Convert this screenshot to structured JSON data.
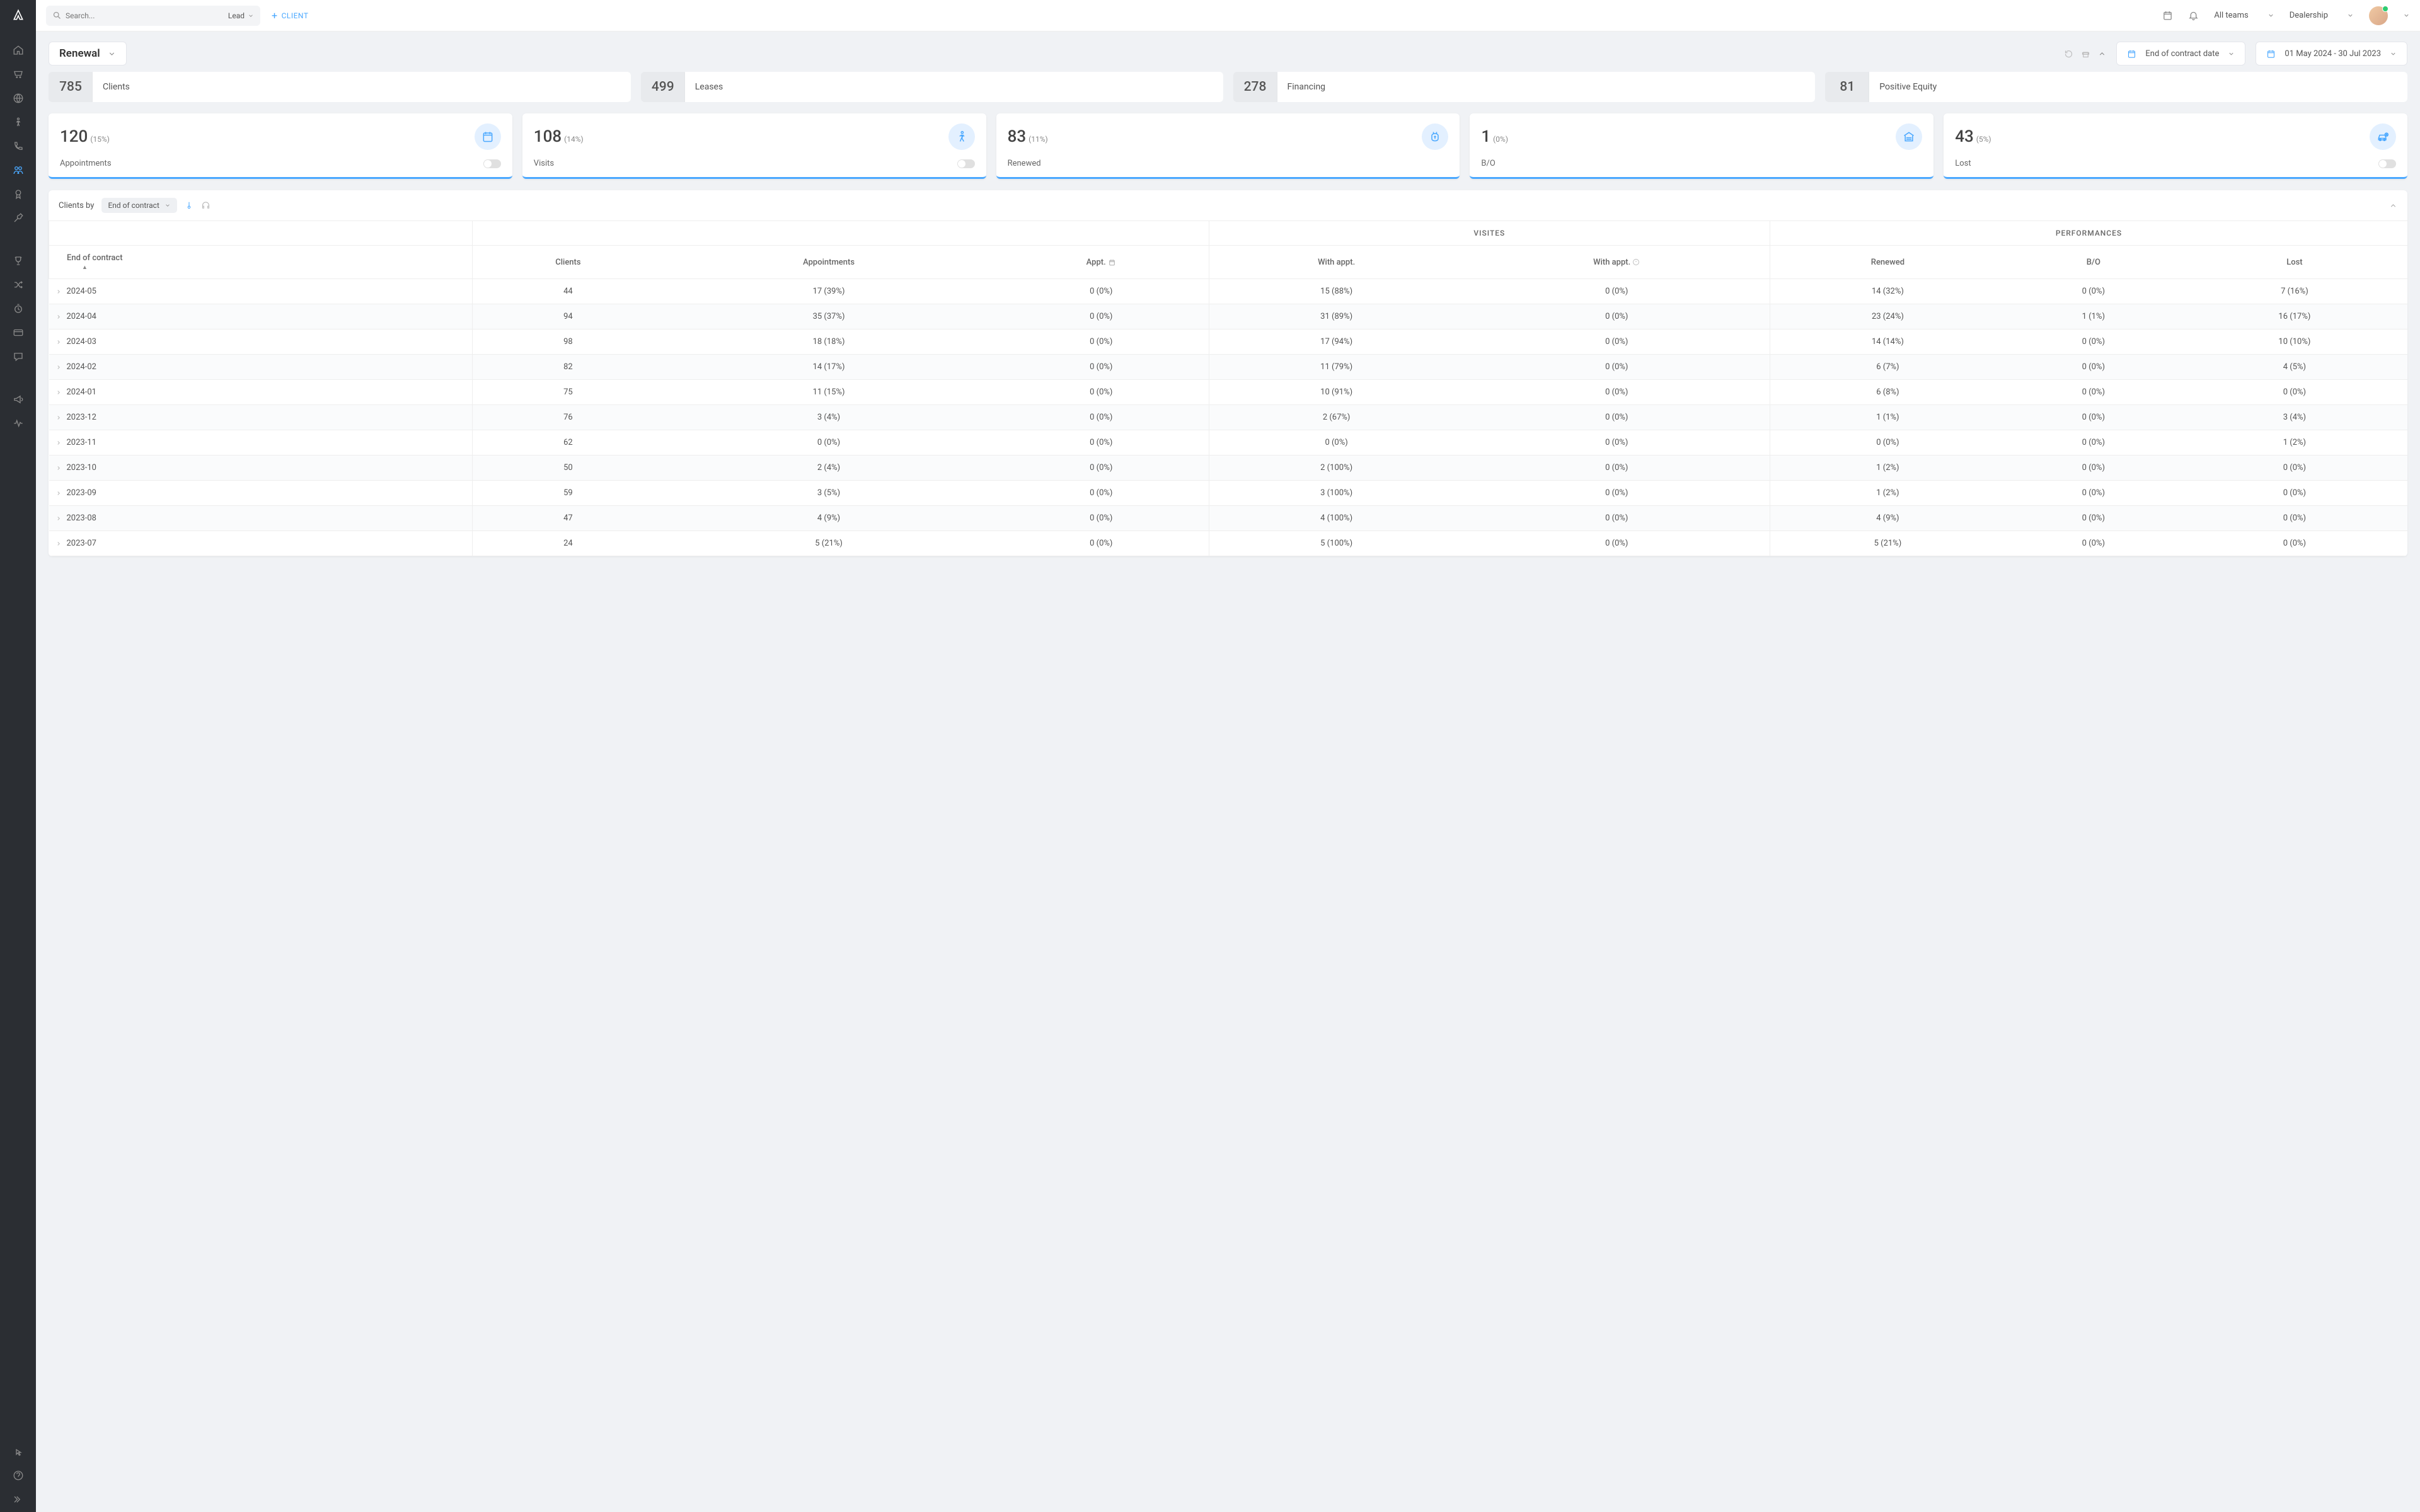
{
  "topbar": {
    "search_placeholder": "Search...",
    "search_type": "Lead",
    "client_btn": "CLIENT",
    "team_selector": "All teams",
    "scope_selector": "Dealership"
  },
  "page": {
    "title": "Renewal",
    "filter_label": "End of contract date",
    "date_range": "01 May 2024 - 30 Jul 2023"
  },
  "summary": [
    {
      "value": "785",
      "label": "Clients"
    },
    {
      "value": "499",
      "label": "Leases"
    },
    {
      "value": "278",
      "label": "Financing"
    },
    {
      "value": "81",
      "label": "Positive Equity"
    }
  ],
  "metrics": [
    {
      "value": "120",
      "pct": "(15%)",
      "label": "Appointments",
      "icon": "calendar",
      "toggle": true
    },
    {
      "value": "108",
      "pct": "(14%)",
      "label": "Visits",
      "icon": "walk",
      "toggle": true
    },
    {
      "value": "83",
      "pct": "(11%)",
      "label": "Renewed",
      "icon": "money",
      "toggle": false
    },
    {
      "value": "1",
      "pct": "(0%)",
      "label": "B/O",
      "icon": "garage",
      "toggle": false
    },
    {
      "value": "43",
      "pct": "(5%)",
      "label": "Lost",
      "icon": "lostcar",
      "toggle": true
    }
  ],
  "table": {
    "prefix": "Clients by",
    "group_label": "End of contract",
    "group_headers": {
      "visits": "VISITES",
      "perf": "PERFORMANCES"
    },
    "columns": [
      "End of contract",
      "Clients",
      "Appointments",
      "Appt.",
      "With appt.",
      "With appt.",
      "Renewed",
      "B/O",
      "Lost"
    ],
    "rows": [
      {
        "c": [
          "2024-05",
          "44",
          "17 (39%)",
          "0 (0%)",
          "15 (88%)",
          "0 (0%)",
          "14 (32%)",
          "0 (0%)",
          "7 (16%)"
        ]
      },
      {
        "c": [
          "2024-04",
          "94",
          "35 (37%)",
          "0 (0%)",
          "31 (89%)",
          "0 (0%)",
          "23 (24%)",
          "1 (1%)",
          "16 (17%)"
        ]
      },
      {
        "c": [
          "2024-03",
          "98",
          "18 (18%)",
          "0 (0%)",
          "17 (94%)",
          "0 (0%)",
          "14 (14%)",
          "0 (0%)",
          "10 (10%)"
        ]
      },
      {
        "c": [
          "2024-02",
          "82",
          "14 (17%)",
          "0 (0%)",
          "11 (79%)",
          "0 (0%)",
          "6 (7%)",
          "0 (0%)",
          "4 (5%)"
        ]
      },
      {
        "c": [
          "2024-01",
          "75",
          "11 (15%)",
          "0 (0%)",
          "10 (91%)",
          "0 (0%)",
          "6 (8%)",
          "0 (0%)",
          "0 (0%)"
        ]
      },
      {
        "c": [
          "2023-12",
          "76",
          "3 (4%)",
          "0 (0%)",
          "2 (67%)",
          "0 (0%)",
          "1 (1%)",
          "0 (0%)",
          "3 (4%)"
        ]
      },
      {
        "c": [
          "2023-11",
          "62",
          "0 (0%)",
          "0 (0%)",
          "0 (0%)",
          "0 (0%)",
          "0 (0%)",
          "0 (0%)",
          "1 (2%)"
        ]
      },
      {
        "c": [
          "2023-10",
          "50",
          "2 (4%)",
          "0 (0%)",
          "2 (100%)",
          "0 (0%)",
          "1 (2%)",
          "0 (0%)",
          "0 (0%)"
        ]
      },
      {
        "c": [
          "2023-09",
          "59",
          "3 (5%)",
          "0 (0%)",
          "3 (100%)",
          "0 (0%)",
          "1 (2%)",
          "0 (0%)",
          "0 (0%)"
        ]
      },
      {
        "c": [
          "2023-08",
          "47",
          "4 (9%)",
          "0 (0%)",
          "4 (100%)",
          "0 (0%)",
          "4 (9%)",
          "0 (0%)",
          "0 (0%)"
        ]
      },
      {
        "c": [
          "2023-07",
          "24",
          "5 (21%)",
          "0 (0%)",
          "5 (100%)",
          "0 (0%)",
          "5 (21%)",
          "0 (0%)",
          "0 (0%)"
        ]
      }
    ]
  }
}
